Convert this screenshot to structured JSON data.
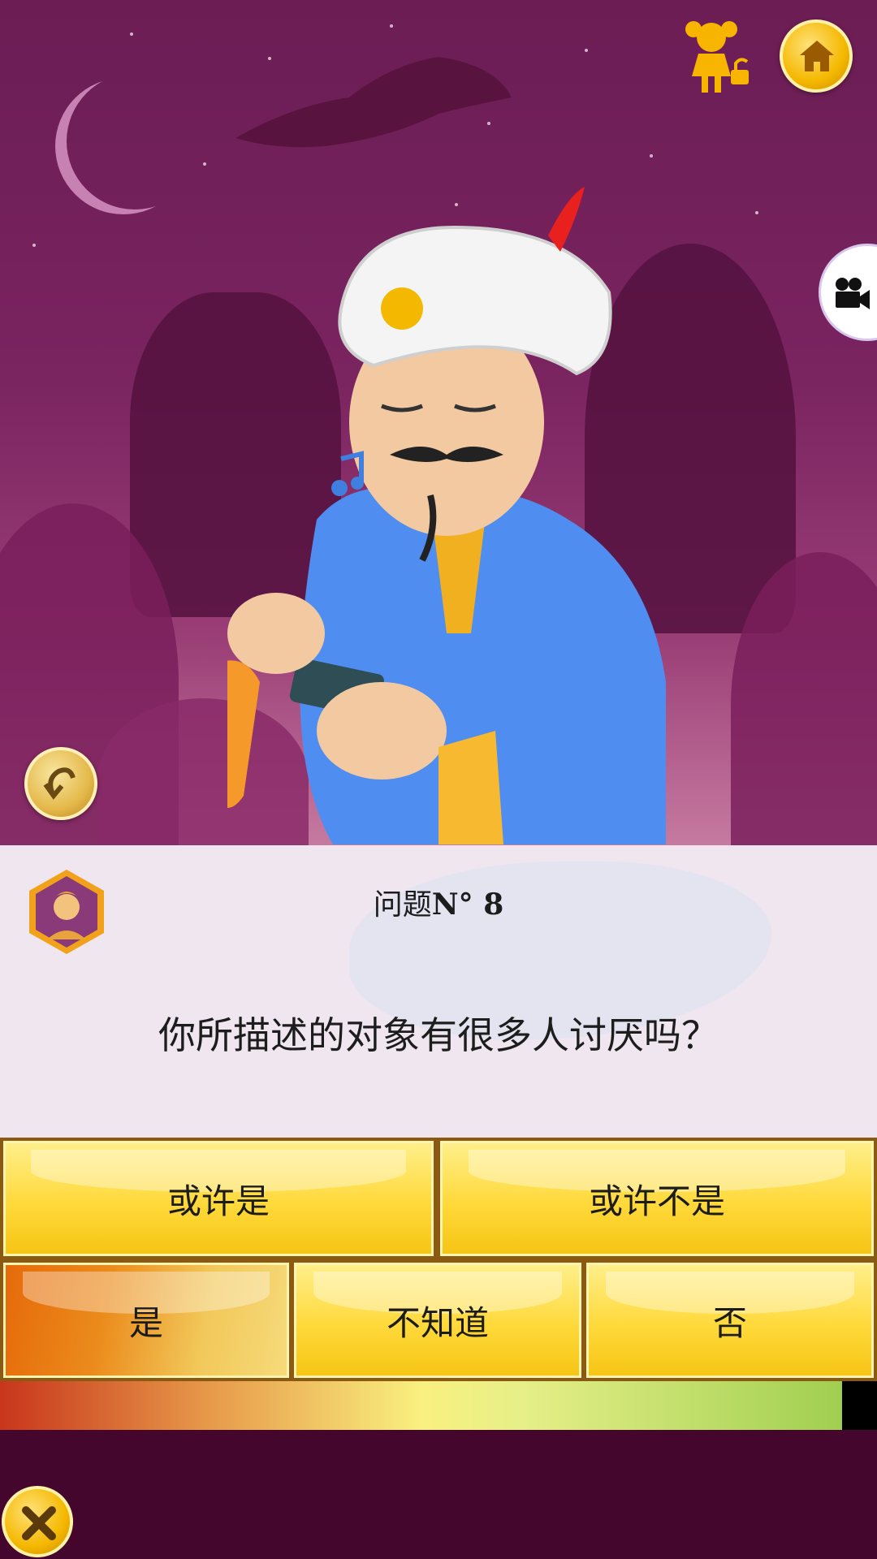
{
  "header": {
    "kid_mode_icon": "girl-lock-icon",
    "home_icon": "home-icon",
    "video_icon": "video-camera-icon",
    "undo_icon": "undo-arrow-icon"
  },
  "question": {
    "label": "问题",
    "number_prefix": "N° ",
    "number": "8",
    "text": "你所描述的对象有很多人讨厌吗？"
  },
  "answers": {
    "probably": "或许是",
    "probably_not": "或许不是",
    "yes": "是",
    "dont_know": "不知道",
    "no": "否",
    "selected": "yes"
  },
  "progress": {
    "fraction": 0.96
  },
  "colors": {
    "accent_gold": "#f5b800",
    "answer_yellow": "#ffd93a",
    "selected_orange": "#e66a0a",
    "background_purple": "#6b1d54"
  },
  "footer": {
    "close_icon": "close-x-icon"
  }
}
